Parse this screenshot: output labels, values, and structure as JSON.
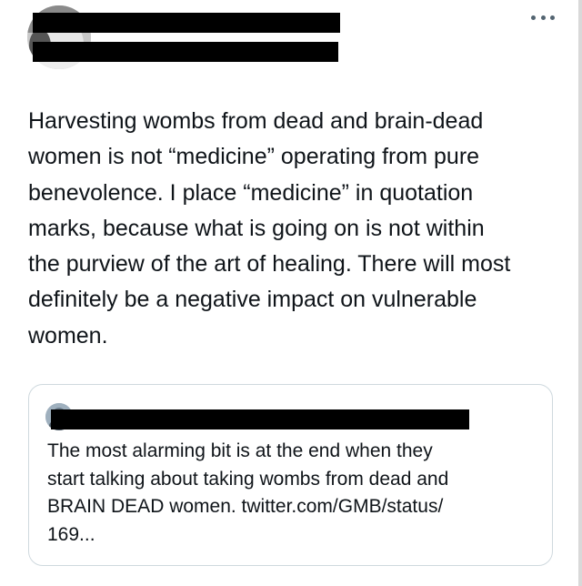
{
  "author": {
    "avatar_icon": "profile-photo",
    "name": "",
    "handle": ""
  },
  "menu": {
    "icon": "more-options-icon"
  },
  "tweet": {
    "lines": [
      "Harvesting wombs from dead and brain-dead",
      "women is not “medicine” operating from pure",
      "benevolence. I place “medicine” in quotation",
      "marks, because what is going on is not within",
      "the purview of the art of healing. There will most",
      "definitely be a negative impact on vulnerable",
      "women."
    ]
  },
  "quoted_tweet": {
    "author_name": "",
    "lines": [
      "The most alarming bit is at the end when they",
      "start talking about taking wombs from dead and",
      "BRAIN DEAD women. twitter.com/GMB/status/",
      "169..."
    ]
  },
  "colors": {
    "text": "#0f1419",
    "secondary": "#536471",
    "border": "#cfd9de",
    "redaction": "#000000"
  }
}
